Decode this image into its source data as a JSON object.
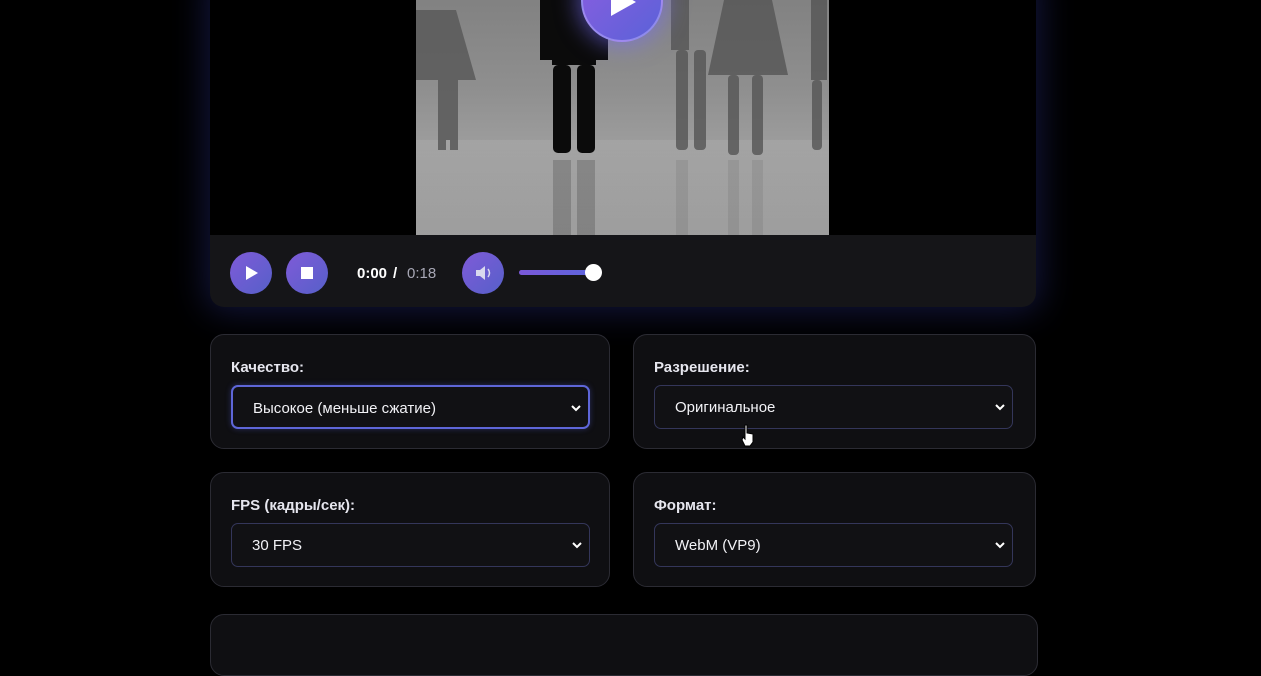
{
  "player": {
    "current_time": "0:00",
    "separator": "/",
    "duration": "0:18",
    "volume_fraction": 0.97
  },
  "settings": {
    "quality": {
      "label": "Качество:",
      "value": "Высокое (меньше сжатие)"
    },
    "resolution": {
      "label": "Разрешение:",
      "value": "Оригинальное"
    },
    "fps": {
      "label": "FPS (кадры/сек):",
      "value": "30 FPS"
    },
    "format": {
      "label": "Формат:",
      "value": "WebM (VP9)"
    }
  },
  "icons": {
    "big_play": "play-icon",
    "play": "play-icon",
    "stop": "stop-icon",
    "mute": "volume-icon",
    "dropdown": "chevron-down-icon",
    "cursor": "hand-pointer-icon"
  },
  "colors": {
    "accent_start": "#8c5de0",
    "accent_end": "#5a62d8",
    "panel": "#151518",
    "background": "#000000"
  }
}
